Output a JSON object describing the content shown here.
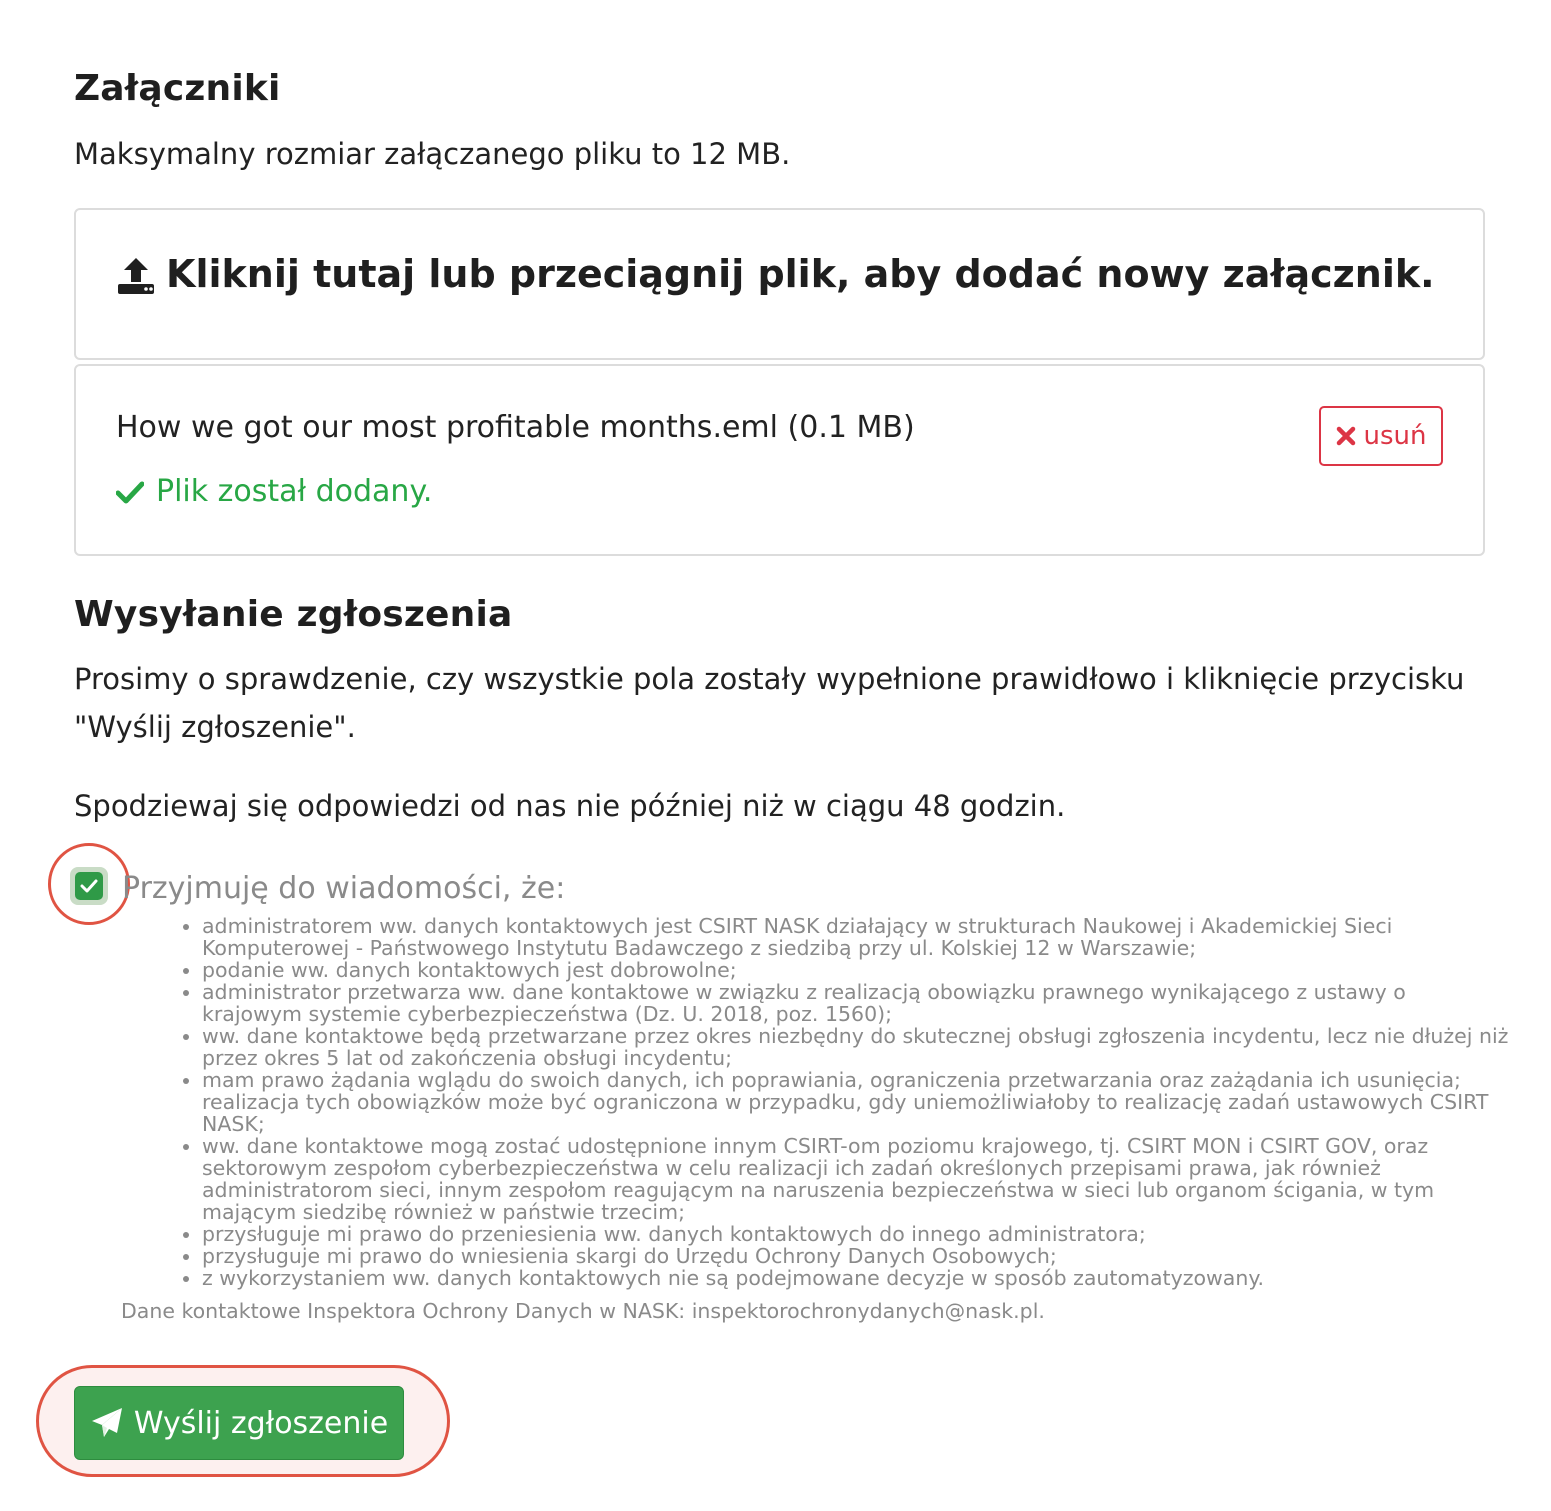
{
  "attachments": {
    "title": "Załączniki",
    "max_size_text": "Maksymalny rozmiar załączanego pliku to 12 MB.",
    "dropzone_text": "Kliknij tutaj lub przeciągnij plik, aby dodać nowy załącznik.",
    "file": {
      "name": "How we got our most profitable months.eml (0.1 MB)",
      "status": "Plik został dodany.",
      "remove_label": "usuń"
    }
  },
  "submission": {
    "title": "Wysyłanie zgłoszenia",
    "instructions": "Prosimy o sprawdzenie, czy wszystkie pola zostały wypełnione prawidłowo i kliknięcie przycisku \"Wyślij zgłoszenie\".",
    "response_time": "Spodziewaj się odpowiedzi od nas nie później niż w ciągu 48 godzin.",
    "consent": {
      "checked": true,
      "label": "Przyjmuję do wiadomości, że:",
      "items": [
        "administratorem ww. danych kontaktowych jest CSIRT NASK działający w strukturach Naukowej i Akademickiej Sieci Komputerowej - Państwowego Instytutu Badawczego z siedzibą przy ul. Kolskiej 12 w Warszawie;",
        "podanie ww. danych kontaktowych jest dobrowolne;",
        "administrator przetwarza ww. dane kontaktowe w związku z realizacją obowiązku prawnego wynikającego z ustawy o krajowym systemie cyberbezpieczeństwa (Dz. U. 2018, poz. 1560);",
        "ww. dane kontaktowe będą przetwarzane przez okres niezbędny do skutecznej obsługi zgłoszenia incydentu, lecz nie dłużej niż przez okres 5 lat od zakończenia obsługi incydentu;",
        "mam prawo żądania wglądu do swoich danych, ich poprawiania, ograniczenia przetwarzania oraz zażądania ich usunięcia; realizacja tych obowiązków może być ograniczona w przypadku, gdy uniemożliwiałoby to realizację zadań ustawowych CSIRT NASK;",
        "ww. dane kontaktowe mogą zostać udostępnione innym CSIRT-om poziomu krajowego, tj. CSIRT MON i CSIRT GOV, oraz sektorowym zespołom cyberbezpieczeństwa w celu realizacji ich zadań określonych przepisami prawa, jak również administratorom sieci, innym zespołom reagującym na naruszenia bezpieczeństwa w sieci lub organom ścigania, w tym mającym siedzibę również w państwie trzecim;",
        "przysługuje mi prawo do przeniesienia ww. danych kontaktowych do innego administratora;",
        "przysługuje mi prawo do wniesienia skargi do Urzędu Ochrony Danych Osobowych;",
        "z wykorzystaniem ww. danych kontaktowych nie są podejmowane decyzje w sposób zautomatyzowany."
      ],
      "iod_contact": "Dane kontaktowe Inspektora Ochrony Danych w NASK: inspektorochronydanych@nask.pl."
    },
    "submit_label": "Wyślij zgłoszenie"
  },
  "colors": {
    "success": "#28a745",
    "danger": "#dc3545",
    "submit": "#3da24f",
    "highlight": "#e05443"
  },
  "icons": {
    "dropzone": "upload-icon",
    "status": "check-icon",
    "remove": "x-icon",
    "submit": "paper-plane-icon"
  }
}
